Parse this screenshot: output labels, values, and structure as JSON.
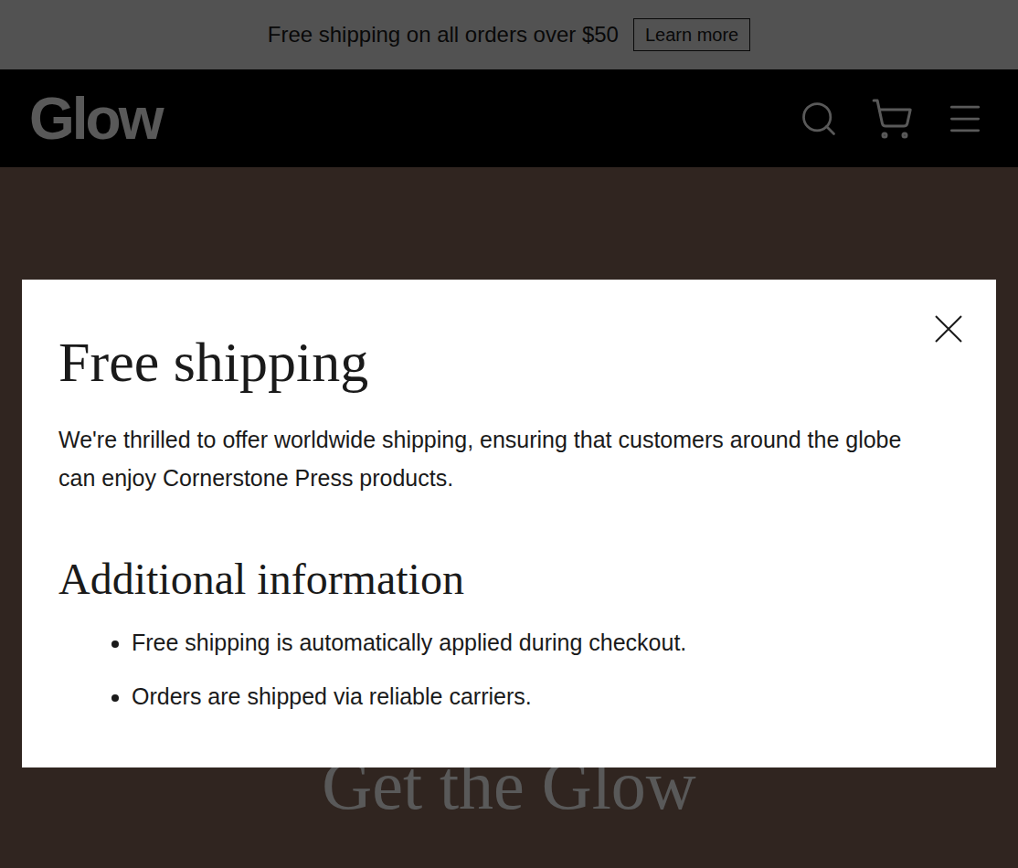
{
  "announcement": {
    "text": "Free shipping on all orders over $50",
    "button": "Learn more"
  },
  "header": {
    "logo": "Glow"
  },
  "hero": {
    "title": "Get the Glow"
  },
  "modal": {
    "title": "Free shipping",
    "body": "We're thrilled to offer worldwide shipping, ensuring that customers around the globe can enjoy Cornerstone Press products.",
    "subtitle": "Additional information",
    "items": [
      "Free shipping is automatically applied during checkout.",
      "Orders are shipped via reliable carriers."
    ]
  }
}
